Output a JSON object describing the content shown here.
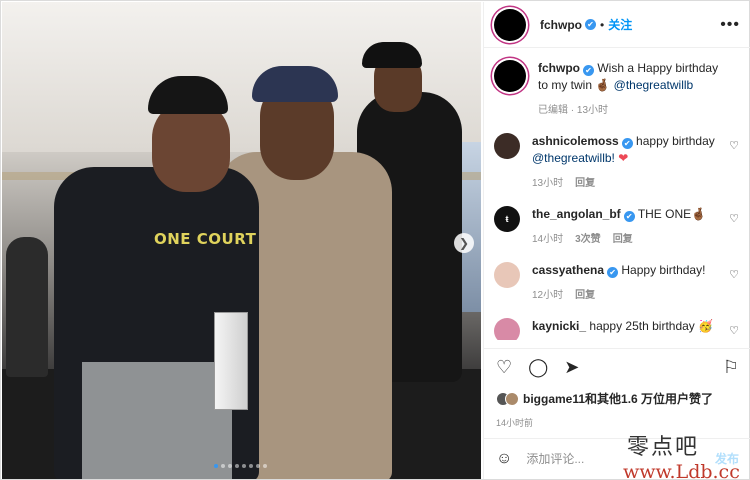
{
  "post": {
    "author": "fchwpo",
    "verified_mark": "✔",
    "separator": "•",
    "follow_label": "关注",
    "more_icon": "more-horizontal-icon",
    "shirt_text": "ONE COURT"
  },
  "caption": {
    "user": "fchwpo",
    "text": "Wish a Happy birthday to my twin 🤞🏾",
    "mention": "@thegreatwillb",
    "meta": "已编辑 · 13小时"
  },
  "comments": [
    {
      "user": "ashnicolemoss",
      "text": "happy birthday",
      "mention": "@thegreatwillb!",
      "emoji": "❤",
      "time": "13小时",
      "reply": "回复",
      "likes": ""
    },
    {
      "user": "the_angolan_bf",
      "text": "THE ONE🤞🏾",
      "mention": "",
      "emoji": "",
      "time": "14小时",
      "likes": "3次赞",
      "reply": "回复"
    },
    {
      "user": "cassyathena",
      "text": "Happy birthday!",
      "mention": "",
      "emoji": "",
      "time": "12小时",
      "reply": "回复",
      "likes": ""
    },
    {
      "user": "kaynicki_",
      "text": "happy 25th birthday 🥳",
      "mention": "",
      "emoji": "",
      "time": "",
      "reply": "",
      "likes": ""
    }
  ],
  "actions": {
    "like_icon": "heart-icon",
    "comment_icon": "comment-icon",
    "share_icon": "send-icon",
    "save_icon": "bookmark-icon"
  },
  "likes": {
    "user": "biggame11",
    "text": "和其他1.6 万位用户赞了"
  },
  "post_time": "14小时前",
  "add_comment": {
    "placeholder": "添加评论...",
    "post_label": "发布"
  },
  "watermark": {
    "line1": "零点吧",
    "line2": "www.Ldb.cc"
  },
  "carousel": {
    "slides": 8,
    "active": 0
  },
  "colors": {
    "accent": "#0095f6",
    "verified": "#3897f0",
    "ring": "#c13584"
  }
}
